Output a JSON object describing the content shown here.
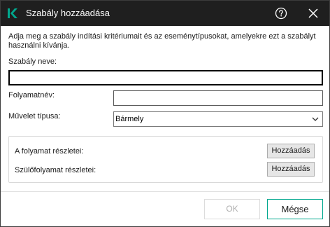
{
  "window": {
    "title": "Szabály hozzáadása",
    "logo_icon": "kaspersky-k-logo",
    "help_icon": "help-circle-icon",
    "close_icon": "close-icon"
  },
  "description": "Adja meg a szabály indítási kritériumait és az eseménytípusokat, amelyekre ezt a szabályt használni kívánja.",
  "form": {
    "rule_name_label": "Szabály neve:",
    "rule_name_value": "",
    "process_name_label": "Folyamatnév:",
    "process_name_value": "",
    "operation_type_label": "Művelet típusa:",
    "operation_type_value": "Bármely"
  },
  "details": {
    "process_details_label": "A folyamat részletei:",
    "process_details_button": "Hozzáadás",
    "parent_details_label": "Szülőfolyamat részletei:",
    "parent_details_button": "Hozzáadás"
  },
  "footer": {
    "ok_label": "OK",
    "cancel_label": "Mégse"
  },
  "colors": {
    "titlebar": "#1f1f1f",
    "brand_accent": "#00a88e",
    "disabled_text": "#b0b0b0"
  }
}
